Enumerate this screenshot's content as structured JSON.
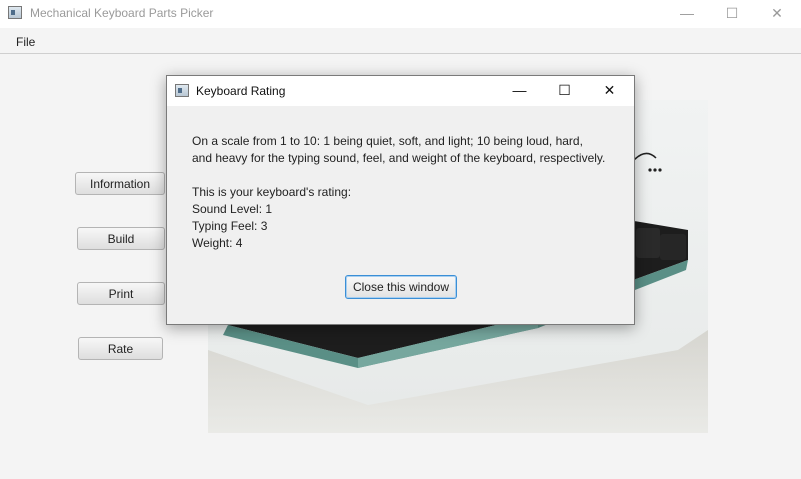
{
  "window": {
    "title": "Mechanical Keyboard Parts Picker",
    "minimize_glyph": "—",
    "maximize_glyph": "☐",
    "close_glyph": "✕"
  },
  "menu": {
    "file_label": "File"
  },
  "sidebar": {
    "information_label": "Information",
    "build_label": "Build",
    "print_label": "Print",
    "rate_label": "Rate"
  },
  "dialog": {
    "title": "Keyboard Rating",
    "description_line1": "On a scale from 1 to 10: 1 being quiet, soft, and light; 10 being loud, hard,",
    "description_line2": "and heavy for the typing sound, feel, and weight of the keyboard, respectively.",
    "rating_header": "This is your keyboard's rating:",
    "sound_level": "Sound Level: 1",
    "typing_feel": "Typing Feel: 3",
    "weight": "Weight: 4",
    "close_button_label": "Close this window"
  },
  "icons": {
    "app": "app-window-icon",
    "minimize": "minimize-icon",
    "maximize": "maximize-icon",
    "close": "close-icon"
  }
}
